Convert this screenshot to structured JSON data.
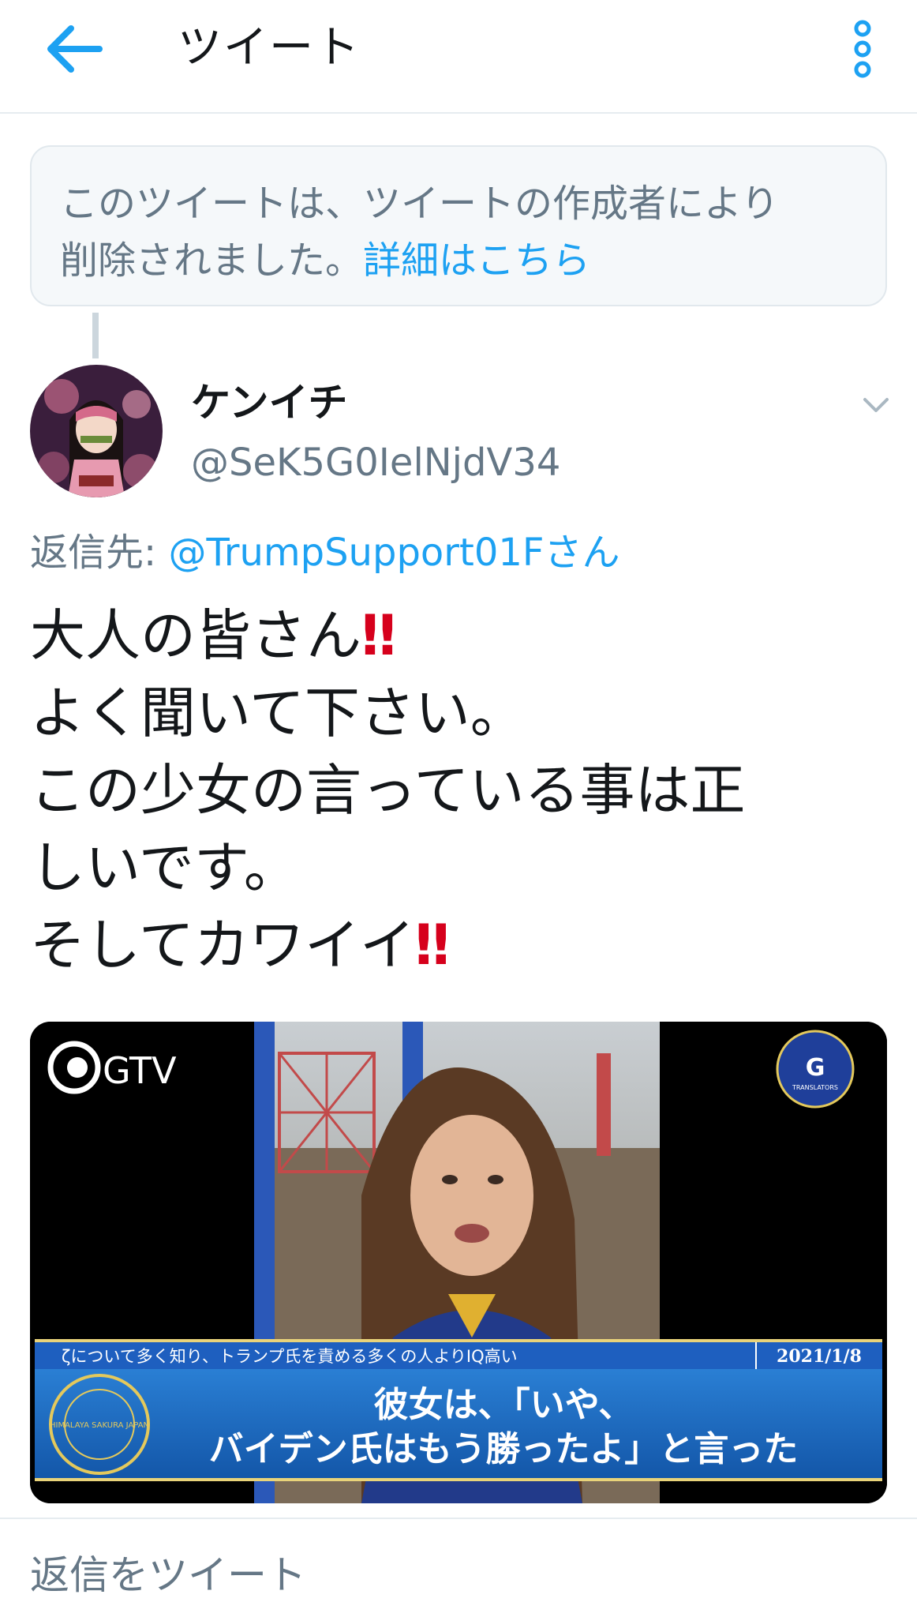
{
  "header": {
    "title": "ツイート",
    "back_icon": "arrow-left-icon",
    "more_icon": "more-vertical-icon",
    "accent": "#1da1f2"
  },
  "deleted_notice": {
    "text_line1": "このツイートは、ツイートの作成者により",
    "text_line2": "削除されました。",
    "link": "詳細はこちら"
  },
  "tweet": {
    "author_name": "ケンイチ",
    "author_handle": "@SeK5G0IelNjdV34",
    "reply_prefix": "返信先: ",
    "reply_handle": "@TrumpSupport01Fさん",
    "lines": [
      {
        "text": "大人の皆さん",
        "emoji": "‼"
      },
      {
        "text": "よく聞いて下さい。",
        "emoji": ""
      },
      {
        "text": "この少女の言っている事は正",
        "emoji": ""
      },
      {
        "text": "しいです。",
        "emoji": ""
      },
      {
        "text": "そしてカワイイ",
        "emoji": "‼"
      }
    ]
  },
  "media": {
    "channel_logo": "GTV",
    "translators_badge": "G",
    "translators_text": "TRANSLATORS",
    "ticker": "ζについて多く知り、トランプ氏を責める多くの人よりIQ高い",
    "date": "2021/1/8",
    "subtitle_line1": "彼女は、「いや、",
    "subtitle_line2": "バイデン氏はもう勝ったよ」と言った",
    "seal_text": "HIMALAYA SAKURA JAPAN"
  },
  "reply_box": {
    "placeholder": "返信をツイート"
  }
}
